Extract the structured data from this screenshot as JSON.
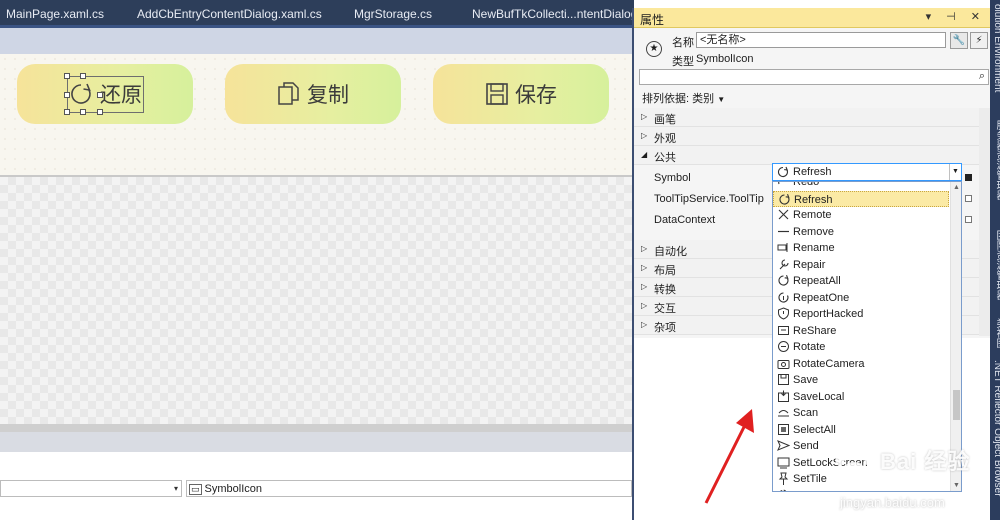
{
  "tabs": [
    {
      "label": "MainPage.xaml.cs"
    },
    {
      "label": "AddCbEntryContentDialog.xaml.cs"
    },
    {
      "label": "MgrStorage.cs"
    },
    {
      "label": "NewBufTkCollecti...ntentDialog.x"
    }
  ],
  "designer": {
    "buttons": [
      {
        "label": "还原",
        "icon": "refresh-icon"
      },
      {
        "label": "复制",
        "icon": "copy-icon"
      },
      {
        "label": "保存",
        "icon": "save-icon"
      }
    ]
  },
  "bottom_nav": {
    "element_combo": "SymbolIcon"
  },
  "properties": {
    "title": "属性",
    "title_buttons": "▾ ⊣ ✕",
    "name_label": "名称",
    "name_value": "<无名称>",
    "type_label": "类型",
    "type_value": "SymbolIcon",
    "sort_label": "排列依据: 类别",
    "categories_top": [
      {
        "label": "画笔",
        "arrow": "▷"
      },
      {
        "label": "外观",
        "arrow": "▷"
      },
      {
        "label": "公共",
        "arrow": "◢"
      }
    ],
    "props": [
      {
        "name": "Symbol"
      },
      {
        "name": "ToolTipService.ToolTip"
      },
      {
        "name": "DataContext"
      }
    ],
    "categories_bottom": [
      {
        "label": "自动化",
        "arrow": "▷"
      },
      {
        "label": "布局",
        "arrow": "▷"
      },
      {
        "label": "转换",
        "arrow": "▷"
      },
      {
        "label": "交互",
        "arrow": "▷"
      },
      {
        "label": "杂项",
        "arrow": "▷"
      }
    ],
    "symbol_value": "Refresh"
  },
  "symbol_dropdown": {
    "items": [
      {
        "label": "Redo",
        "icon": "redo-icon"
      },
      {
        "label": "Refresh",
        "icon": "refresh-icon",
        "selected": true
      },
      {
        "label": "Remote",
        "icon": "remote-icon"
      },
      {
        "label": "Remove",
        "icon": "remove-icon"
      },
      {
        "label": "Rename",
        "icon": "rename-icon"
      },
      {
        "label": "Repair",
        "icon": "repair-icon"
      },
      {
        "label": "RepeatAll",
        "icon": "repeat-all-icon"
      },
      {
        "label": "RepeatOne",
        "icon": "repeat-one-icon"
      },
      {
        "label": "ReportHacked",
        "icon": "shield-icon"
      },
      {
        "label": "ReShare",
        "icon": "reshare-icon"
      },
      {
        "label": "Rotate",
        "icon": "rotate-icon"
      },
      {
        "label": "RotateCamera",
        "icon": "rotate-camera-icon"
      },
      {
        "label": "Save",
        "icon": "save-icon"
      },
      {
        "label": "SaveLocal",
        "icon": "save-local-icon"
      },
      {
        "label": "Scan",
        "icon": "scan-icon"
      },
      {
        "label": "SelectAll",
        "icon": "select-all-icon"
      },
      {
        "label": "Send",
        "icon": "send-icon"
      },
      {
        "label": "SetLockScreen",
        "icon": "lock-screen-icon"
      },
      {
        "label": "SetTile",
        "icon": "pin-icon"
      },
      {
        "label": "Settings",
        "icon": "gear-icon"
      }
    ]
  },
  "side_tabs": [
    {
      "label": "olution Environment"
    },
    {
      "label": "服务器资源管理器"
    },
    {
      "label": "团队资源管理器"
    },
    {
      "label": "类视图"
    },
    {
      "label": ".NET Reflector Object Browser"
    }
  ],
  "watermark": {
    "brand": "Bai 经验",
    "url": "jingyan.baidu.com"
  }
}
